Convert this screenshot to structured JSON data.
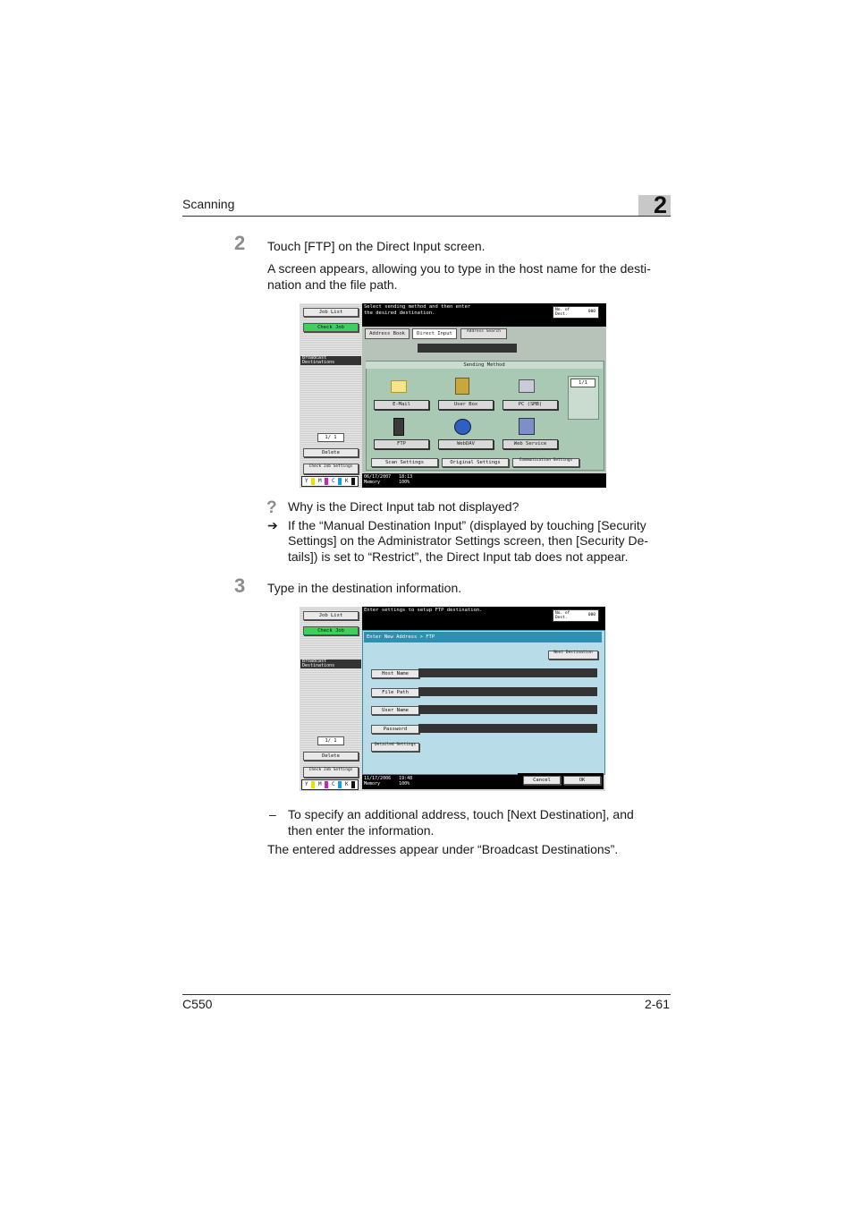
{
  "header": {
    "section": "Scanning",
    "chapter": "2"
  },
  "step2": {
    "num": "2",
    "instruction": "Touch [FTP] on the Direct Input screen.",
    "para1": "A screen appears, allowing you to type in the host name for the desti-",
    "para2": "nation and the file path."
  },
  "screen1": {
    "job_list": "Job List",
    "check_job": "Check Job",
    "broadcast": "Broadcast Destinations",
    "message1": "Select sending method and then enter",
    "message2": "the desired destination.",
    "tabs": [
      "Address Book",
      "Direct Input",
      "Address Search"
    ],
    "sending_method": "Sending Method",
    "page_count": "1/1",
    "methods": [
      "E-Mail",
      "User Box",
      "PC (SMB)",
      "FTP",
      "WebDAV",
      "Web Service"
    ],
    "bottom_buttons": [
      "Scan Settings",
      "Original Settings",
      "Communication Settings"
    ],
    "counter": "1/ 1",
    "delete": "Delete",
    "check_job_settings": "Check Job Settings",
    "date": "06/17/2007",
    "time": "18:13",
    "memory": "Memory",
    "memory_pct": "100%",
    "mem_label": "No. of Dest.",
    "mem_count": "000",
    "cmyk": [
      "Y",
      "M",
      "C",
      "K"
    ]
  },
  "tip": {
    "question": "Why is the Direct Input tab not displayed?",
    "answer1": "If the “Manual Destination Input” (displayed by touching [Security",
    "answer2": "Settings] on the Administrator Settings screen, then [Security De-",
    "answer3": "tails]) is set to “Restrict”, the Direct Input tab does not appear."
  },
  "step3": {
    "num": "3",
    "instruction": "Type in the destination information."
  },
  "screen2": {
    "job_list": "Job List",
    "check_job": "Check Job",
    "broadcast": "Broadcast Destinations",
    "message": "Enter settings to setup FTP destination.",
    "breadcrumb": "Enter New Address > FTP",
    "next_dest": "Next Destination",
    "fields": [
      "Host Name",
      "File Path",
      "User Name",
      "Password",
      "Detailed Settings"
    ],
    "counter": "1/ 1",
    "delete": "Delete",
    "check_job_settings": "Check Job Settings",
    "date": "11/17/2006",
    "time": "19:48",
    "memory": "Memory",
    "memory_pct": "100%",
    "cancel": "Cancel",
    "ok": "OK",
    "mem_label": "No. of Dest.",
    "mem_count": "000",
    "cmyk": [
      "Y",
      "M",
      "C",
      "K"
    ]
  },
  "after": {
    "bullet": "To specify an additional address, touch [Next Destination], and",
    "bullet2": "then enter the information.",
    "note": "The entered addresses appear under “Broadcast Destinations”."
  },
  "footer": {
    "model": "C550",
    "page": "2-61"
  }
}
